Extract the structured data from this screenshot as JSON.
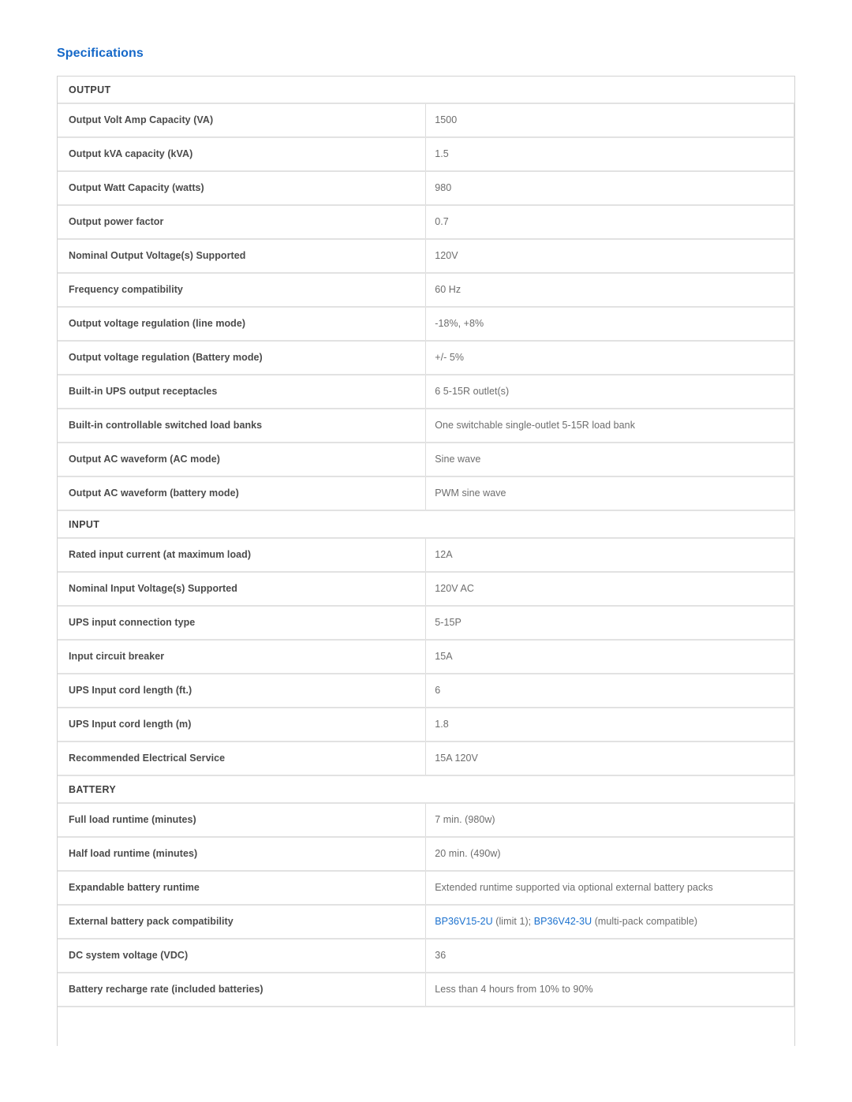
{
  "page": {
    "heading": "Specifications"
  },
  "spec_table": {
    "sections": [
      {
        "title": "OUTPUT",
        "rows": [
          {
            "label": "Output Volt Amp Capacity (VA)",
            "value": "1500"
          },
          {
            "label": "Output kVA capacity (kVA)",
            "value": "1.5"
          },
          {
            "label": "Output Watt Capacity (watts)",
            "value": "980"
          },
          {
            "label": "Output power factor",
            "value": "0.7"
          },
          {
            "label": "Nominal Output Voltage(s) Supported",
            "value": "120V"
          },
          {
            "label": "Frequency compatibility",
            "value": "60 Hz"
          },
          {
            "label": "Output voltage regulation (line mode)",
            "value": "-18%, +8%"
          },
          {
            "label": "Output voltage regulation (Battery mode)",
            "value": "+/- 5%"
          },
          {
            "label": "Built-in UPS output receptacles",
            "value": "6 5-15R outlet(s)"
          },
          {
            "label": "Built-in controllable switched load banks",
            "value": "One switchable single-outlet 5-15R load bank"
          },
          {
            "label": "Output AC waveform (AC mode)",
            "value": "Sine wave"
          },
          {
            "label": "Output AC waveform (battery mode)",
            "value": "PWM sine wave"
          }
        ]
      },
      {
        "title": "INPUT",
        "rows": [
          {
            "label": "Rated input current (at maximum load)",
            "value": "12A"
          },
          {
            "label": "Nominal Input Voltage(s) Supported",
            "value": "120V AC"
          },
          {
            "label": "UPS input connection type",
            "value": "5-15P"
          },
          {
            "label": "Input circuit breaker",
            "value": "15A"
          },
          {
            "label": "UPS Input cord length (ft.)",
            "value": "6"
          },
          {
            "label": "UPS Input cord length (m)",
            "value": "1.8"
          },
          {
            "label": "Recommended Electrical Service",
            "value": "15A 120V"
          }
        ]
      },
      {
        "title": "BATTERY",
        "rows": [
          {
            "label": "Full load runtime (minutes)",
            "value": "7 min. (980w)"
          },
          {
            "label": "Half load runtime (minutes)",
            "value": "20 min. (490w)"
          },
          {
            "label": "Expandable battery runtime",
            "value": "Extended runtime supported via optional external battery packs"
          },
          {
            "label": "External battery pack compatibility",
            "value": ""
          },
          {
            "label": "DC system voltage (VDC)",
            "value": "36"
          },
          {
            "label": "Battery recharge rate (included batteries)",
            "value": "Less than 4 hours from 10% to 90%"
          }
        ]
      }
    ],
    "battery_pack_row": {
      "link1": "BP36V15-2U",
      "text1": " (limit 1); ",
      "link2": "BP36V42-3U",
      "text2": " (multi-pack compatible)"
    }
  },
  "colors": {
    "heading_blue": "#1568c8",
    "link_blue": "#1b71ce",
    "label_text": "#4b4b4b",
    "value_text": "#6d6d6d",
    "section_text": "#3f3f3f",
    "border": "#e2e2e2",
    "table_border": "#d2d2d2"
  }
}
